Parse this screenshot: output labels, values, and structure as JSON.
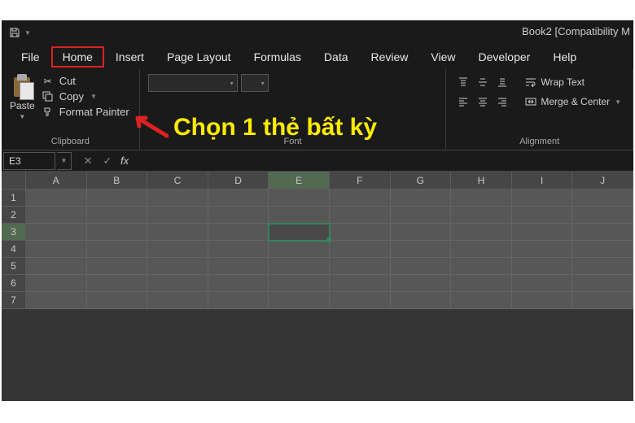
{
  "title": "Book2  [Compatibility M",
  "tabs": [
    "File",
    "Home",
    "Insert",
    "Page Layout",
    "Formulas",
    "Data",
    "Review",
    "View",
    "Developer",
    "Help"
  ],
  "active_tab": "Home",
  "clipboard": {
    "paste": "Paste",
    "cut": "Cut",
    "copy": "Copy",
    "format_painter": "Format Painter",
    "label": "Clipboard"
  },
  "font": {
    "label": "Font"
  },
  "alignment": {
    "wrap": "Wrap Text",
    "merge": "Merge & Center",
    "label": "Alignment"
  },
  "annotation": "Chọn 1 thẻ bất kỳ",
  "namebox": "E3",
  "fx": "fx",
  "columns": [
    "A",
    "B",
    "C",
    "D",
    "E",
    "F",
    "G",
    "H",
    "I",
    "J"
  ],
  "rows": [
    "1",
    "2",
    "3",
    "4",
    "5",
    "6",
    "7"
  ],
  "active_cell": {
    "row": "3",
    "col": "E"
  }
}
